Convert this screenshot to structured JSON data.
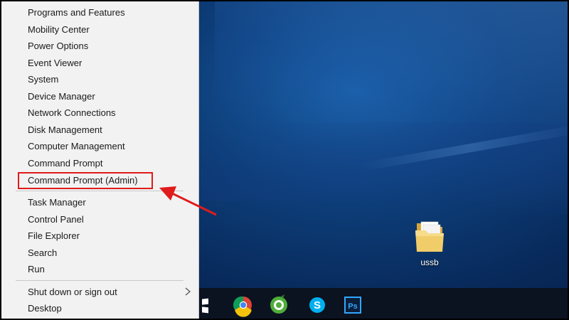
{
  "menu": {
    "items": [
      {
        "label": "Programs and Features"
      },
      {
        "label": "Mobility Center"
      },
      {
        "label": "Power Options"
      },
      {
        "label": "Event Viewer"
      },
      {
        "label": "System"
      },
      {
        "label": "Device Manager"
      },
      {
        "label": "Network Connections"
      },
      {
        "label": "Disk Management"
      },
      {
        "label": "Computer Management"
      },
      {
        "label": "Command Prompt"
      },
      {
        "label": "Command Prompt (Admin)"
      },
      {
        "label": "Task Manager"
      },
      {
        "label": "Control Panel"
      },
      {
        "label": "File Explorer"
      },
      {
        "label": "Search"
      },
      {
        "label": "Run"
      },
      {
        "label": "Shut down or sign out"
      },
      {
        "label": "Desktop"
      }
    ],
    "submenu_icon": "chevron-right-icon"
  },
  "annotation": {
    "highlight_color": "#e01b1b"
  },
  "desktop": {
    "folder_label": "ussb",
    "folder_icon": "folder-icon"
  },
  "taskbar": {
    "icons": [
      "start-icon",
      "chrome-icon",
      "coccoc-icon",
      "skype-icon",
      "photoshop-icon"
    ]
  },
  "colors": {
    "menu_bg": "#f2f2f2",
    "desktop_blue": "#0d3d78",
    "taskbar_bg": "#0b1220"
  }
}
